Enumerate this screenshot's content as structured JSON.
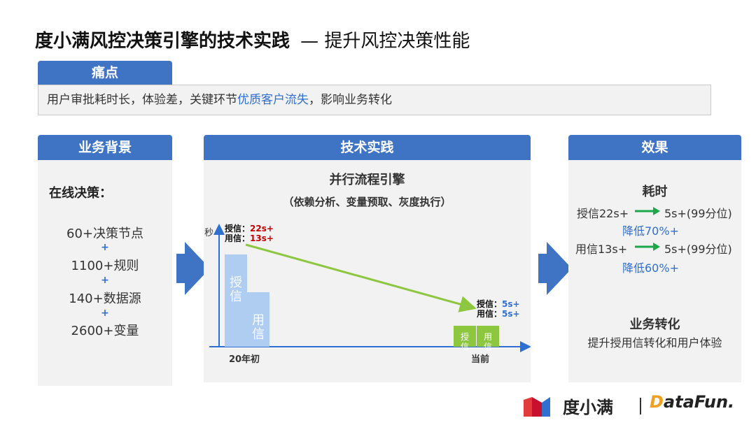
{
  "title": {
    "main": "度小满风控决策引擎的技术实践",
    "sub": "— 提升风控决策性能"
  },
  "pain": {
    "tab": "痛点",
    "text_before": "用户审批耗时长，体验差，关键环节",
    "text_highlight": "优质客户流失",
    "text_after": "，影响业务转化"
  },
  "background": {
    "tab": "业务背景",
    "heading": "在线决策：",
    "items": [
      "60+决策节点",
      "1100+规则",
      "140+数据源",
      "2600+变量"
    ],
    "plus": "+"
  },
  "practice": {
    "tab": "技术实践",
    "heading": "并行流程引擎",
    "subheading": "（依赖分析、变量预取、灰度执行）",
    "chart_data": {
      "type": "bar",
      "ylabel": "秒",
      "categories": [
        "20年初",
        "当前"
      ],
      "series": [
        {
          "name": "授信",
          "values": [
            22,
            5
          ],
          "display": [
            "22s+",
            "5s+"
          ]
        },
        {
          "name": "用信",
          "values": [
            13,
            5
          ],
          "display": [
            "13s+",
            "5s+"
          ]
        }
      ],
      "annotation_sep": "："
    }
  },
  "effect": {
    "tab": "效果",
    "time_heading": "耗时",
    "line1_from": "授信22s+",
    "line1_to": "5s+(99分位)",
    "line1_reduce": "降低70%+",
    "line2_from": "用信13s+",
    "line2_to": "5s+(99分位)",
    "line2_reduce": "降低60%+",
    "biz_heading": "业务转化",
    "biz_text": "提升授用信转化和用户体验"
  },
  "footer": {
    "brand": "度小满",
    "partner_d": "D",
    "partner_rest": "ataFun."
  },
  "colors": {
    "accent": "#3f73c4",
    "highlight": "#2f6fd0",
    "bar_blue": "#aecdf0",
    "bar_green": "#8dc63f",
    "red_value": "#c00000",
    "arrow_green": "#1aa84a"
  }
}
